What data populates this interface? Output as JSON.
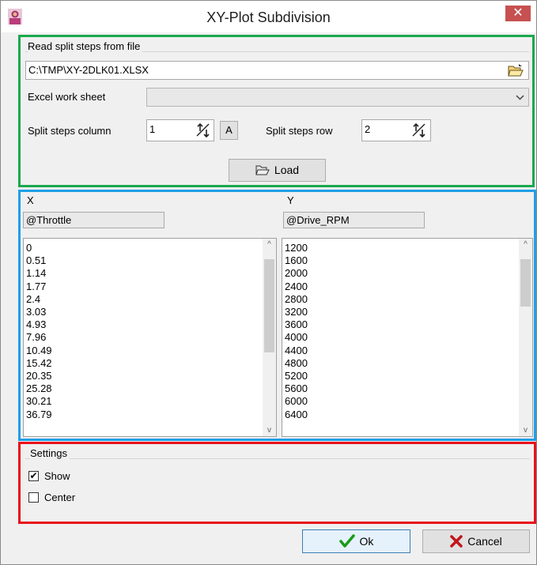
{
  "window": {
    "title": "XY-Plot Subdivision",
    "close_glyph": "✕"
  },
  "file_section": {
    "title": "Read split steps from file",
    "file_path": "C:\\TMP\\XY-2DLK01.XLSX",
    "sheet_label": "Excel work sheet",
    "sheet_value": "",
    "column_label": "Split steps column",
    "column_value": "1",
    "column_letter": "A",
    "row_label": "Split steps row",
    "row_value": "2",
    "load_label": "Load"
  },
  "data_section": {
    "x_header": "X",
    "x_name": "@Throttle",
    "x_values": [
      "0",
      "0.51",
      "1.14",
      "1.77",
      "2.4",
      "3.03",
      "4.93",
      "7.96",
      "10.49",
      "15.42",
      "20.35",
      "25.28",
      "30.21",
      "36.79"
    ],
    "y_header": "Y",
    "y_name": "@Drive_RPM",
    "y_values": [
      "1200",
      "1600",
      "2000",
      "2400",
      "2800",
      "3200",
      "3600",
      "4000",
      "4400",
      "4800",
      "5200",
      "5600",
      "6000",
      "6400"
    ]
  },
  "settings": {
    "title": "Settings",
    "show_label": "Show",
    "show_checked": true,
    "center_label": "Center",
    "center_checked": false
  },
  "footer": {
    "ok_label": "Ok",
    "cancel_label": "Cancel"
  },
  "colors": {
    "ok_check": "#1a9a1a",
    "cancel_x": "#c0151b",
    "close_bg": "#c75050"
  }
}
